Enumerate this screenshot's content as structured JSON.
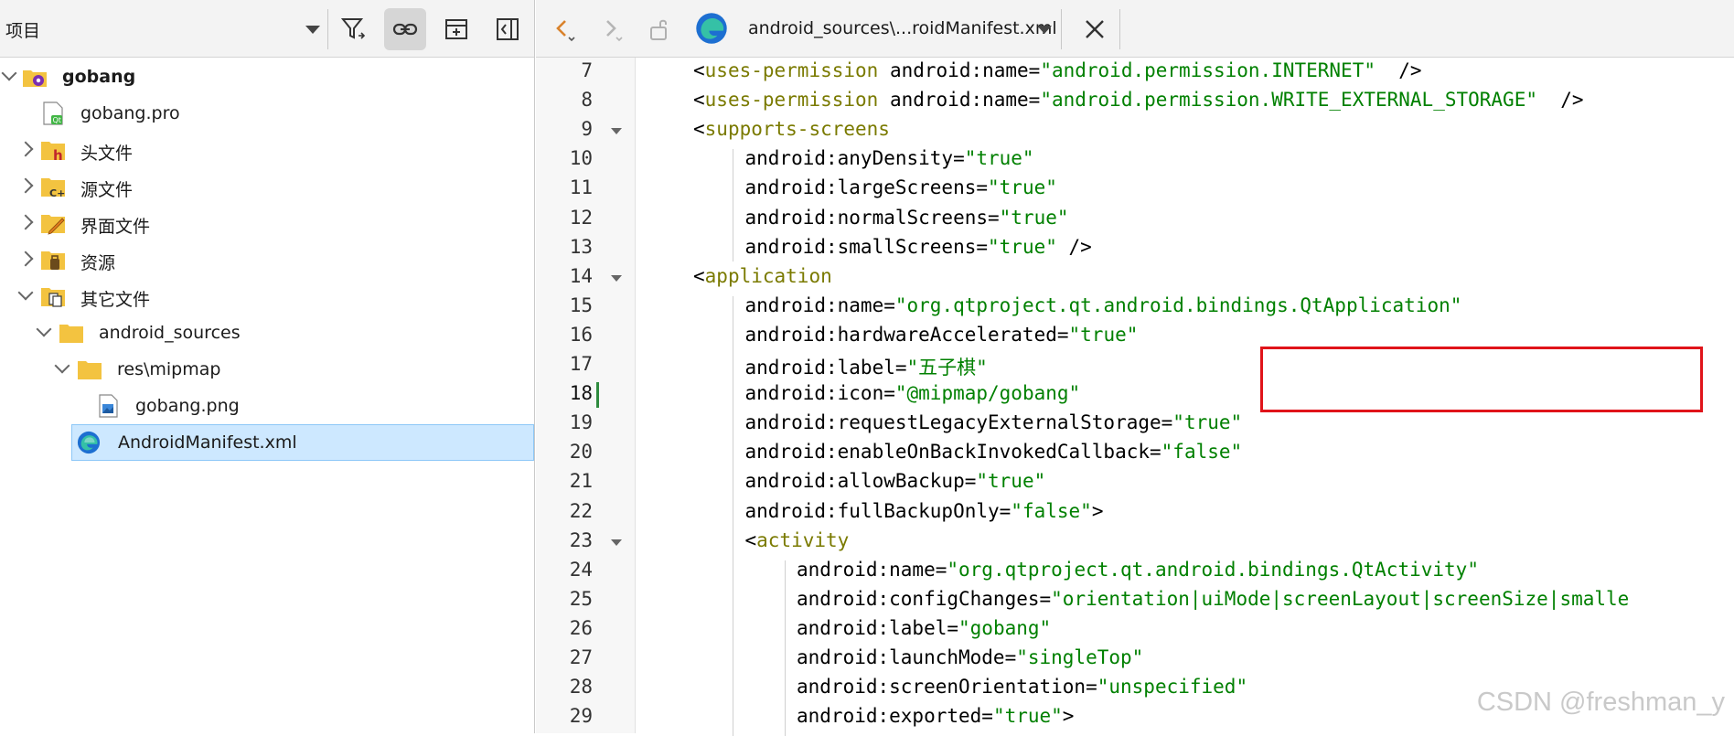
{
  "left_panel": {
    "title": "项目",
    "tree": [
      {
        "label": "gobang",
        "level": 0,
        "expanded": true,
        "icon": "qt-project-icon",
        "bold": true
      },
      {
        "label": "gobang.pro",
        "level": 1,
        "icon": "qt-pro-file-icon"
      },
      {
        "label": "头文件",
        "level": 1,
        "expanded": false,
        "icon": "header-folder-icon"
      },
      {
        "label": "源文件",
        "level": 1,
        "expanded": false,
        "icon": "source-folder-icon"
      },
      {
        "label": "界面文件",
        "level": 1,
        "expanded": false,
        "icon": "forms-folder-icon"
      },
      {
        "label": "资源",
        "level": 1,
        "expanded": false,
        "icon": "resources-folder-icon"
      },
      {
        "label": "其它文件",
        "level": 1,
        "expanded": true,
        "icon": "other-files-folder-icon"
      },
      {
        "label": "android_sources",
        "level": 2,
        "expanded": true,
        "icon": "folder-icon"
      },
      {
        "label": "res\\mipmap",
        "level": 3,
        "expanded": true,
        "icon": "folder-icon"
      },
      {
        "label": "gobang.png",
        "level": 4,
        "icon": "image-file-icon"
      },
      {
        "label": "AndroidManifest.xml",
        "level": 3,
        "icon": "edge-xml-icon",
        "selected": true
      }
    ]
  },
  "editor": {
    "file_title": "android_sources\\...roidManifest.xml",
    "current_line": 18,
    "lines": [
      {
        "n": "7",
        "indent": 1,
        "tokens": [
          [
            "<",
            ""
          ],
          [
            "uses-permission",
            "tag"
          ],
          [
            " android:name=",
            ""
          ],
          [
            "\"android.permission.INTERNET\"",
            "str"
          ],
          [
            "  />",
            ""
          ]
        ]
      },
      {
        "n": "8",
        "indent": 1,
        "tokens": [
          [
            "<",
            ""
          ],
          [
            "uses-permission",
            "tag"
          ],
          [
            " android:name=",
            ""
          ],
          [
            "\"android.permission.WRITE_EXTERNAL_STORAGE\"",
            "str"
          ],
          [
            "  />",
            ""
          ]
        ]
      },
      {
        "n": "9",
        "indent": 1,
        "fold": true,
        "tokens": [
          [
            "<",
            ""
          ],
          [
            "supports-screens",
            "tag"
          ]
        ]
      },
      {
        "n": "10",
        "indent": 2,
        "tokens": [
          [
            "android:anyDensity=",
            ""
          ],
          [
            "\"true\"",
            "str"
          ]
        ]
      },
      {
        "n": "11",
        "indent": 2,
        "tokens": [
          [
            "android:largeScreens=",
            ""
          ],
          [
            "\"true\"",
            "str"
          ]
        ]
      },
      {
        "n": "12",
        "indent": 2,
        "tokens": [
          [
            "android:normalScreens=",
            ""
          ],
          [
            "\"true\"",
            "str"
          ]
        ]
      },
      {
        "n": "13",
        "indent": 2,
        "tokens": [
          [
            "android:smallScreens=",
            ""
          ],
          [
            "\"true\"",
            "str"
          ],
          [
            " />",
            ""
          ]
        ]
      },
      {
        "n": "14",
        "indent": 1,
        "fold": true,
        "tokens": [
          [
            "<",
            ""
          ],
          [
            "application",
            "tag"
          ]
        ]
      },
      {
        "n": "15",
        "indent": 2,
        "tokens": [
          [
            "android:name=",
            ""
          ],
          [
            "\"org.qtproject.qt.android.bindings.QtApplication\"",
            "str"
          ]
        ]
      },
      {
        "n": "16",
        "indent": 2,
        "tokens": [
          [
            "android:hardwareAccelerated=",
            ""
          ],
          [
            "\"true\"",
            "str"
          ]
        ]
      },
      {
        "n": "17",
        "indent": 2,
        "tokens": [
          [
            "android:label=",
            ""
          ],
          [
            "\"五子棋\"",
            "str"
          ]
        ]
      },
      {
        "n": "18",
        "indent": 2,
        "tokens": [
          [
            "android:icon=",
            ""
          ],
          [
            "\"@mipmap/gobang\"",
            "str"
          ]
        ]
      },
      {
        "n": "19",
        "indent": 2,
        "tokens": [
          [
            "android:requestLegacyExternalStorage=",
            ""
          ],
          [
            "\"true\"",
            "str"
          ]
        ]
      },
      {
        "n": "20",
        "indent": 2,
        "tokens": [
          [
            "android:enableOnBackInvokedCallback=",
            ""
          ],
          [
            "\"false\"",
            "str"
          ]
        ]
      },
      {
        "n": "21",
        "indent": 2,
        "tokens": [
          [
            "android:allowBackup=",
            ""
          ],
          [
            "\"true\"",
            "str"
          ]
        ]
      },
      {
        "n": "22",
        "indent": 2,
        "tokens": [
          [
            "android:fullBackupOnly=",
            ""
          ],
          [
            "\"false\"",
            "str"
          ],
          [
            ">",
            ""
          ]
        ]
      },
      {
        "n": "23",
        "indent": 2,
        "fold": true,
        "tokens": [
          [
            "<",
            ""
          ],
          [
            "activity",
            "tag"
          ]
        ]
      },
      {
        "n": "24",
        "indent": 3,
        "tokens": [
          [
            "android:name=",
            ""
          ],
          [
            "\"org.qtproject.qt.android.bindings.QtActivity\"",
            "str"
          ]
        ]
      },
      {
        "n": "25",
        "indent": 3,
        "tokens": [
          [
            "android:configChanges=",
            ""
          ],
          [
            "\"orientation|uiMode|screenLayout|screenSize|smalle",
            "str"
          ]
        ]
      },
      {
        "n": "26",
        "indent": 3,
        "tokens": [
          [
            "android:label=",
            ""
          ],
          [
            "\"gobang\"",
            "str"
          ]
        ]
      },
      {
        "n": "27",
        "indent": 3,
        "tokens": [
          [
            "android:launchMode=",
            ""
          ],
          [
            "\"singleTop\"",
            "str"
          ]
        ]
      },
      {
        "n": "28",
        "indent": 3,
        "tokens": [
          [
            "android:screenOrientation=",
            ""
          ],
          [
            "\"unspecified\"",
            "str"
          ]
        ]
      },
      {
        "n": "29",
        "indent": 3,
        "tokens": [
          [
            "android:exported=",
            ""
          ],
          [
            "\"true\"",
            "str"
          ],
          [
            ">",
            ""
          ]
        ]
      }
    ]
  },
  "watermark": "CSDN @freshman_y",
  "colors": {
    "tag": "#7a7a00",
    "string": "#008000",
    "highlight_box": "#e0141a",
    "selection": "#cde8ff"
  }
}
